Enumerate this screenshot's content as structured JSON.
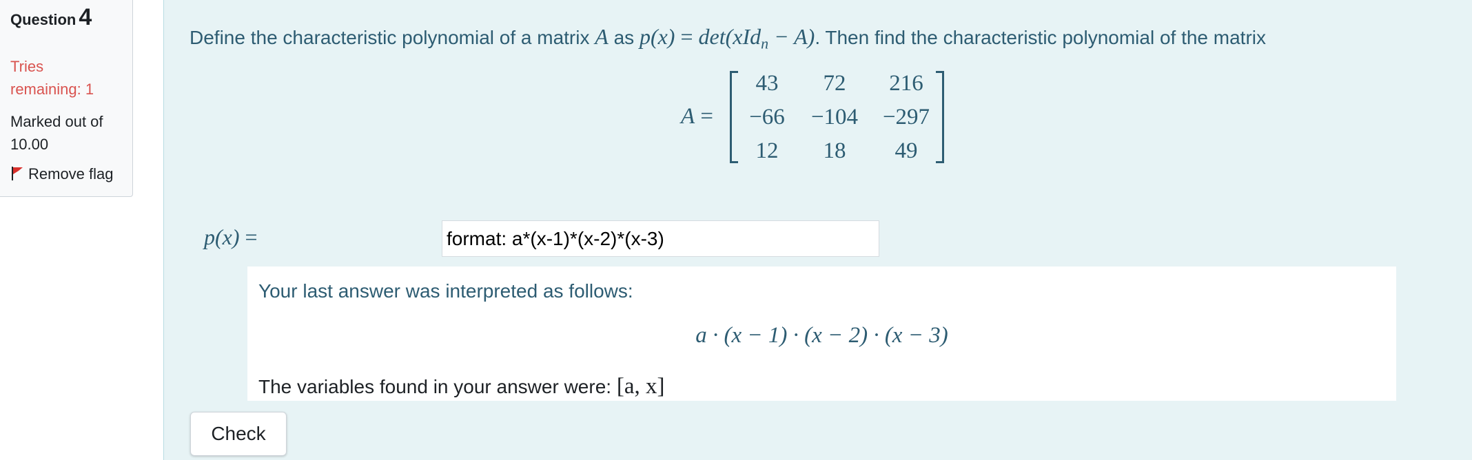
{
  "info": {
    "question_label": "Question",
    "question_number": "4",
    "tries": "Tries remaining: 1",
    "marked": "Marked out of 10.00",
    "flag_label": "Remove flag",
    "flag_icon": "flag-icon"
  },
  "question": {
    "intro": "Define the characteristic polynomial of a matrix ",
    "var_A": "A",
    "as_text": " as ",
    "def_lhs": "p(x)",
    "def_eq": " = ",
    "def_rhs_a": "det(xId",
    "def_rhs_sub": "n",
    "def_rhs_b": " − A)",
    "outro": ". Then find the characteristic polynomial of the matrix"
  },
  "matrix": {
    "name": "A",
    "eq": " =",
    "rows": [
      [
        "43",
        "72",
        "216"
      ],
      [
        "−66",
        "−104",
        "−297"
      ],
      [
        "12",
        "18",
        "49"
      ]
    ]
  },
  "answer": {
    "label_func": "p(x)",
    "label_eq": " =",
    "value": "format: a*(x-1)*(x-2)*(x-3)"
  },
  "feedback": {
    "title": "Your last answer was interpreted as follows:",
    "expression": "a · (x − 1) · (x − 2) · (x − 3)",
    "vars_text": "The variables found in your answer were: ",
    "vars_value": "[a, x]"
  },
  "buttons": {
    "check": "Check"
  },
  "colors": {
    "accent_text": "#2d5c72",
    "panel_bg": "#e7f3f5",
    "tries_color": "#d9534f",
    "flag_color": "#d9302c"
  }
}
